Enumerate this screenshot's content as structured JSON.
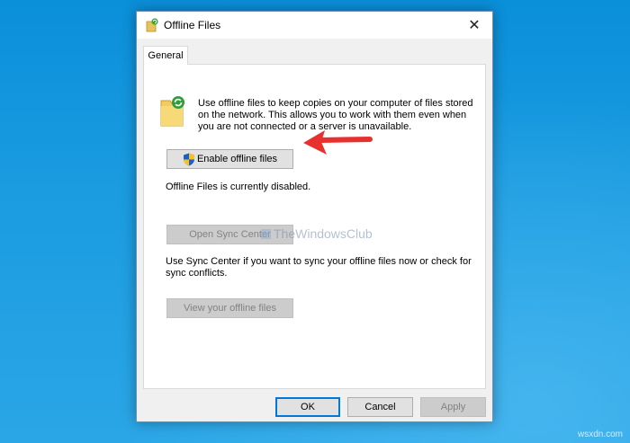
{
  "window": {
    "title": "Offline Files",
    "close_glyph": "✕"
  },
  "tabs": [
    {
      "label": "General",
      "selected": true
    }
  ],
  "general": {
    "intro": "Use offline files to keep copies on your computer of files stored on the network.  This allows you to work with them even when you are not connected or a server is unavailable.",
    "enable_button": "Enable offline files",
    "status": "Offline Files is currently disabled.",
    "sync_button": "Open Sync Center",
    "sync_description": "Use Sync Center if you want to sync your offline files now or check for sync conflicts.",
    "view_button": "View your offline files"
  },
  "footer": {
    "ok": "OK",
    "cancel": "Cancel",
    "apply": "Apply"
  },
  "watermark": "TheWindowsClub",
  "site_label": "wsxdn.com",
  "icons": {
    "title": "offline-files-icon",
    "folder": "sync-folder-icon",
    "shield": "uac-shield-icon",
    "annotation": "red-arrow-icon"
  },
  "colors": {
    "desktop": "#1a9be0",
    "dialog": "#f0f0f0",
    "accent": "#0078d7",
    "arrow": "#e8312f"
  }
}
